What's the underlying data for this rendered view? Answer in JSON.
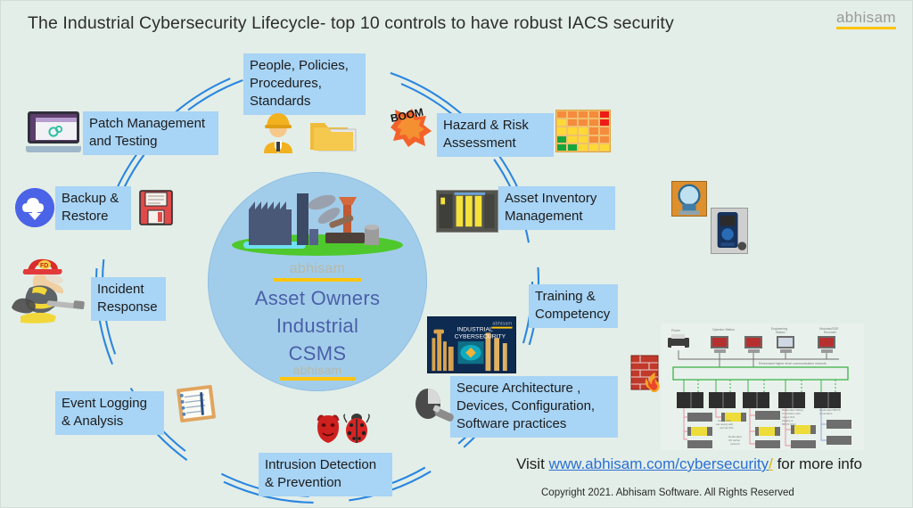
{
  "header": {
    "title": "The Industrial Cybersecurity Lifecycle- top 10 controls to have robust IACS security",
    "logo_word": "abhisam"
  },
  "hub": {
    "watermark_top": "abhisam",
    "line1": "Asset  Owners",
    "line2": "Industrial",
    "line3": "CSMS",
    "watermark_bottom": "abhisam"
  },
  "controls": [
    {
      "id": "people-policies-procedures-standards",
      "label": "People, Policies,\nProcedures,\nStandards",
      "icons": [
        "hard-hat-worker-icon",
        "folders-icon"
      ]
    },
    {
      "id": "hazard-risk-assessment",
      "label": "Hazard & Risk\nAssessment",
      "icons": [
        "boom-explosion-icon",
        "risk-matrix-icon"
      ]
    },
    {
      "id": "asset-inventory-management",
      "label": "Asset Inventory\nManagement",
      "icons": [
        "plc-rack-icon",
        "pressure-transmitter-icon",
        "handheld-communicator-icon"
      ]
    },
    {
      "id": "training-competency",
      "label": "Training &\nCompetency",
      "icons": [
        "course-cover-icon"
      ]
    },
    {
      "id": "secure-architecture",
      "label": "Secure Architecture ,\nDevices, Configuration,\nSoftware practices",
      "icons": [
        "mouse-usb-icon"
      ]
    },
    {
      "id": "intrusion-detection-prevention",
      "label": "Intrusion Detection\n& Prevention",
      "icons": [
        "devil-icon",
        "ladybug-icon"
      ]
    },
    {
      "id": "event-logging-analysis",
      "label": "Event Logging\n& Analysis",
      "icons": [
        "clipboard-icon"
      ]
    },
    {
      "id": "incident-response",
      "label": "Incident\nResponse",
      "icons": [
        "firefighter-icon"
      ]
    },
    {
      "id": "backup-restore",
      "label": "Backup &\nRestore",
      "icons": [
        "cloud-download-icon",
        "floppy-disk-icon"
      ]
    },
    {
      "id": "patch-management-testing",
      "label": "Patch Management\nand Testing",
      "icons": [
        "laptop-gears-icon"
      ]
    }
  ],
  "extras": {
    "firewall_icon": "firewall-flame-icon",
    "network_diagram": "control-system-network-diagram",
    "course_cover_line1": "INDUSTRIAL",
    "course_cover_line2": "CYBERSECURITY",
    "course_cover_watermark": "abhisam"
  },
  "footer": {
    "visit_prefix": "Visit ",
    "url": "www.abhisam.com/cybersecurity",
    "url_slash": "/",
    "visit_suffix": " for more info",
    "copyright": "Copyright 2021. Abhisam Software. All Rights Reserved"
  },
  "colors": {
    "background": "#e3eee8",
    "label_fill": "#a8d4f5",
    "hub_fill": "#a2cdea",
    "ring_stroke": "#2a86e0",
    "hub_text": "#4a5fa8",
    "accent_yellow": "#ffc40c",
    "link_blue": "#2a6fd6"
  }
}
